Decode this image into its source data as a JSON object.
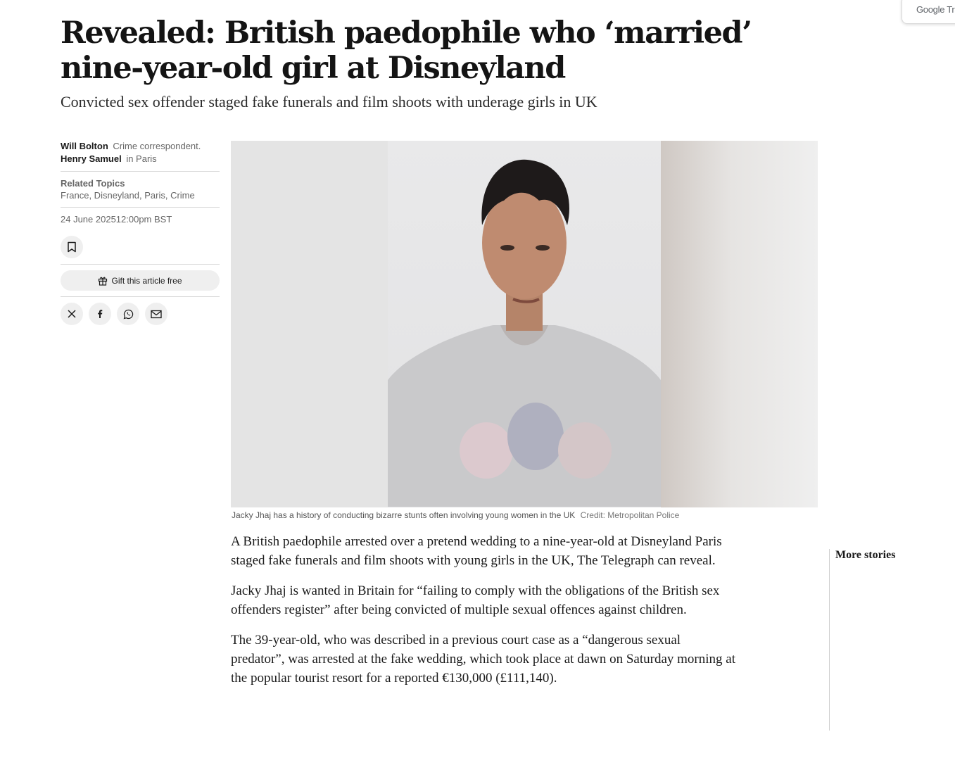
{
  "translate_widget": {
    "label": "Google Tra"
  },
  "article": {
    "headline": "Revealed: British paedophile who ‘married’ nine-year-old girl at Disneyland",
    "standfirst": "Convicted sex offender staged fake funerals and film shoots with underage girls in UK"
  },
  "meta": {
    "authors": [
      {
        "name": "Will Bolton",
        "role": "Crime correspondent."
      },
      {
        "name": "Henry Samuel",
        "role": "in Paris"
      }
    ],
    "topics_label": "Related Topics",
    "topics": "France, Disneyland, Paris, Crime",
    "date": "24 June 2025",
    "time": "12:00pm BST",
    "save_icon": "bookmark-icon",
    "gift_label": "Gift this article free",
    "gift_icon": "gift-icon",
    "share_icons": [
      "x-icon",
      "facebook-icon",
      "whatsapp-icon",
      "email-icon"
    ]
  },
  "photo": {
    "caption": "Jacky Jhaj has a history of conducting bizarre stunts often involving young women in the UK",
    "credit": "Credit: Metropolitan Police"
  },
  "body": {
    "paragraphs": [
      "A British paedophile arrested over a pretend wedding to a nine-year-old at Disneyland Paris staged fake funerals and film shoots with young girls in the UK, The Telegraph can reveal.",
      "Jacky Jhaj is wanted in Britain for “failing to comply with the obligations of the British sex offenders register” after being convicted of multiple sexual offences against children.",
      "The 39-year-old, who was described in a previous court case as a “dangerous sexual predator”, was arrested at the fake wedding, which took place at dawn on Saturday morning at the popular tourist resort for a reported €130,000 (£111,140)."
    ]
  },
  "sidebar": {
    "more_stories": "More stories"
  }
}
